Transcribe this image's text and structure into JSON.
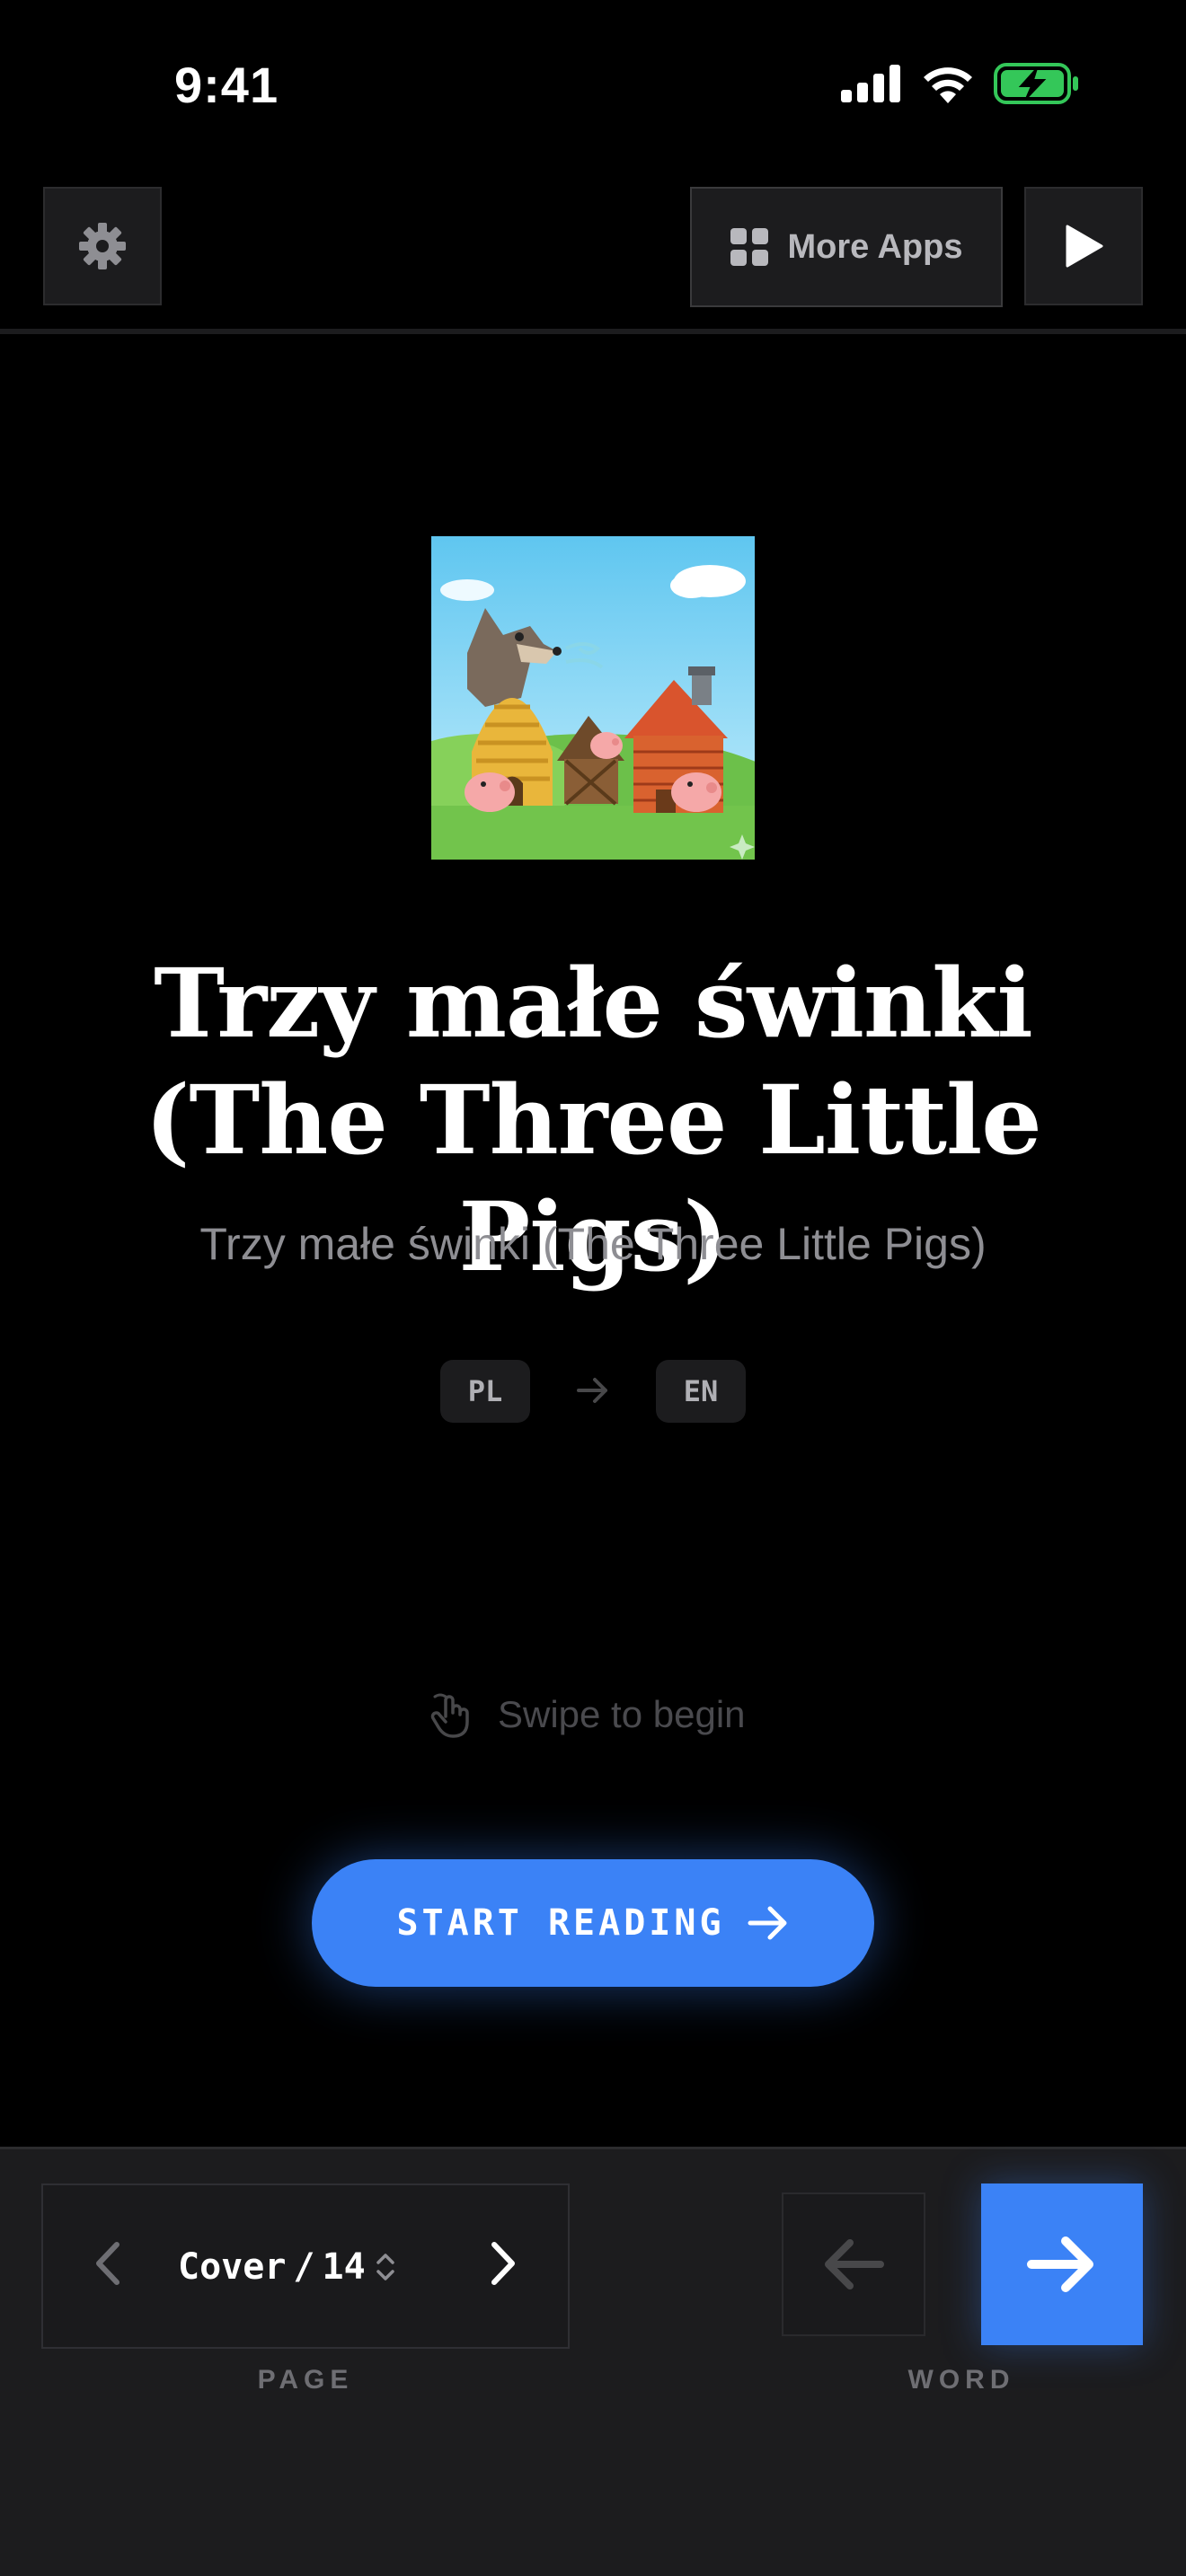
{
  "status_bar": {
    "time": "9:41"
  },
  "top_bar": {
    "settings_icon": "gear-icon",
    "more_apps_label": "More Apps",
    "more_apps_icon": "grid-icon",
    "play_icon": "play-icon"
  },
  "story": {
    "title": "Trzy małe świnki (The Three Little Pigs)",
    "subtitle": "Trzy małe świnki (The Three Little Pigs)",
    "source_language": "PL",
    "target_language": "EN",
    "swipe_hint": "Swipe to begin",
    "start_button_label": "START READING"
  },
  "bottom_bar": {
    "page_current": "Cover",
    "page_separator": "/",
    "page_total": "14",
    "page_label": "PAGE",
    "word_label": "WORD"
  },
  "colors": {
    "accent": "#3b82f6",
    "background": "#000000",
    "surface": "#1c1c1e",
    "battery": "#34c759"
  }
}
